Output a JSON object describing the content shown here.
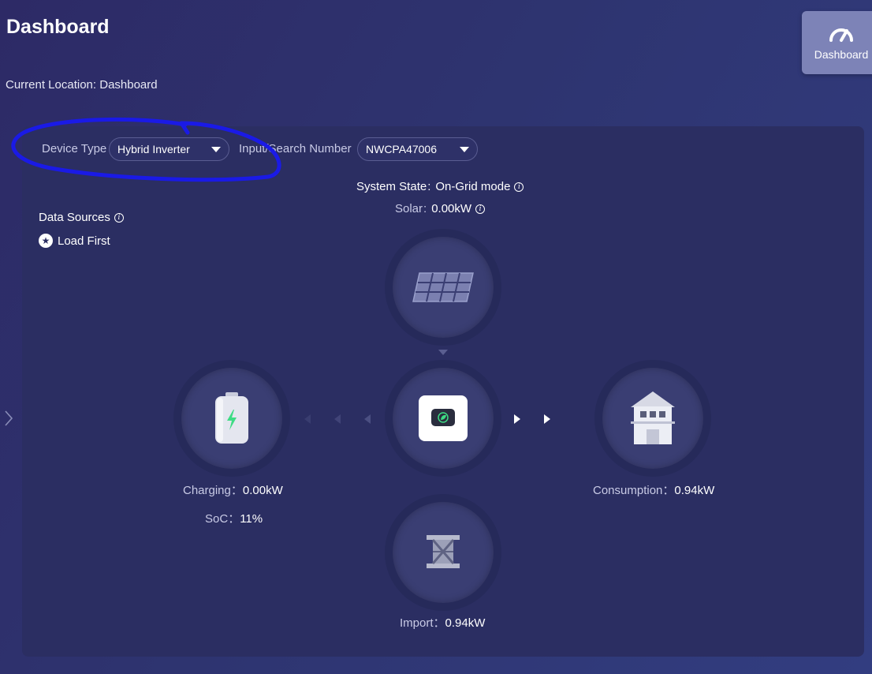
{
  "header": {
    "title": "Dashboard",
    "breadcrumb": "Current Location: Dashboard"
  },
  "nav": {
    "dashboard_label": "Dashboard",
    "dashboard_icon": "speedometer-icon"
  },
  "filters": {
    "device_type_label": "Device Type",
    "device_type_value": "Hybrid Inverter",
    "search_label": "Input/Search Number",
    "search_value": "NWCPA47006"
  },
  "system": {
    "state_label": "System State",
    "state_sep": ":",
    "state_value": "On-Grid mode",
    "solar_label": "Solar",
    "solar_sep": ":",
    "solar_value": "0.00kW"
  },
  "data_sources": {
    "label": "Data Sources",
    "mode": "Load First"
  },
  "battery": {
    "charging_label": "Charging",
    "charging_value": "0.00kW",
    "soc_label": "SoC",
    "soc_value": "11%"
  },
  "consumption": {
    "label": "Consumption",
    "value": "0.94kW"
  },
  "grid": {
    "label": "Import",
    "value": "0.94kW"
  },
  "colors": {
    "annotation": "#1a1ae6",
    "charge_bolt": "#3ddc84",
    "panel": "#2b2e62"
  }
}
